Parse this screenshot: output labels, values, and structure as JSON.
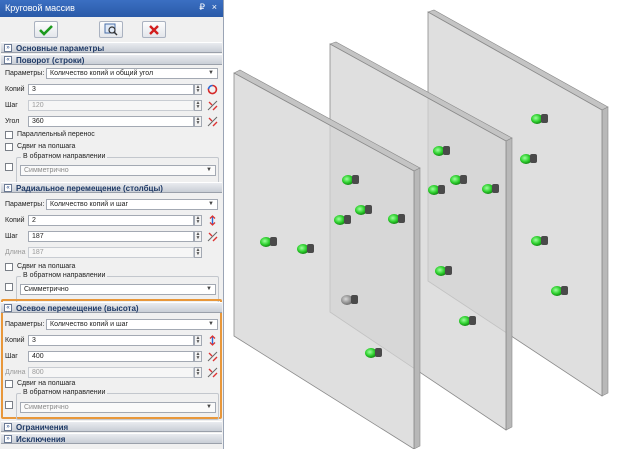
{
  "window": {
    "title": "Круговой массив",
    "pin_glyph": "₽",
    "close_glyph": "×"
  },
  "toolbar": {
    "ok_icon": "checkmark-icon",
    "preview_icon": "preview-icon",
    "cancel_icon": "cancel-icon"
  },
  "sections": {
    "main_params": "Основные параметры",
    "rotation": {
      "title": "Поворот (строки)",
      "params_label": "Параметры:",
      "params_value": "Количество копий и общий угол",
      "copies_label": "Копий",
      "copies_value": "3",
      "step_label": "Шаг",
      "step_value": "120",
      "angle_label": "Угол",
      "angle_value": "360",
      "parallel_label": "Параллельный перенос",
      "halfstep_label": "Сдвиг на полшага",
      "reverse_caption": "В обратном направлении",
      "reverse_value": "Симметрично"
    },
    "radial": {
      "title": "Радиальное перемещение (столбцы)",
      "params_label": "Параметры:",
      "params_value": "Количество копий и шаг",
      "copies_label": "Копий",
      "copies_value": "2",
      "step_label": "Шаг",
      "step_value": "187",
      "length_label": "Длина",
      "length_value": "187",
      "halfstep_label": "Сдвиг на полшага",
      "reverse_caption": "В обратном направлении",
      "reverse_value": "Симметрично"
    },
    "axial": {
      "title": "Осевое перемещение (высота)",
      "params_label": "Параметры:",
      "params_value": "Количество копий и шаг",
      "copies_label": "Копий",
      "copies_value": "3",
      "step_label": "Шаг",
      "step_value": "400",
      "length_label": "Длина",
      "length_value": "800",
      "halfstep_label": "Сдвиг на полшага",
      "reverse_caption": "В обратном направлении",
      "reverse_value": "Симметрично"
    },
    "constraints": "Ограничения",
    "exceptions": "Исключения"
  },
  "colors": {
    "title_bar": "#2d5eae",
    "highlight_border": "#e8973a",
    "pin_green": "#2fd12f",
    "plate_fill": "#d4d4d4"
  }
}
